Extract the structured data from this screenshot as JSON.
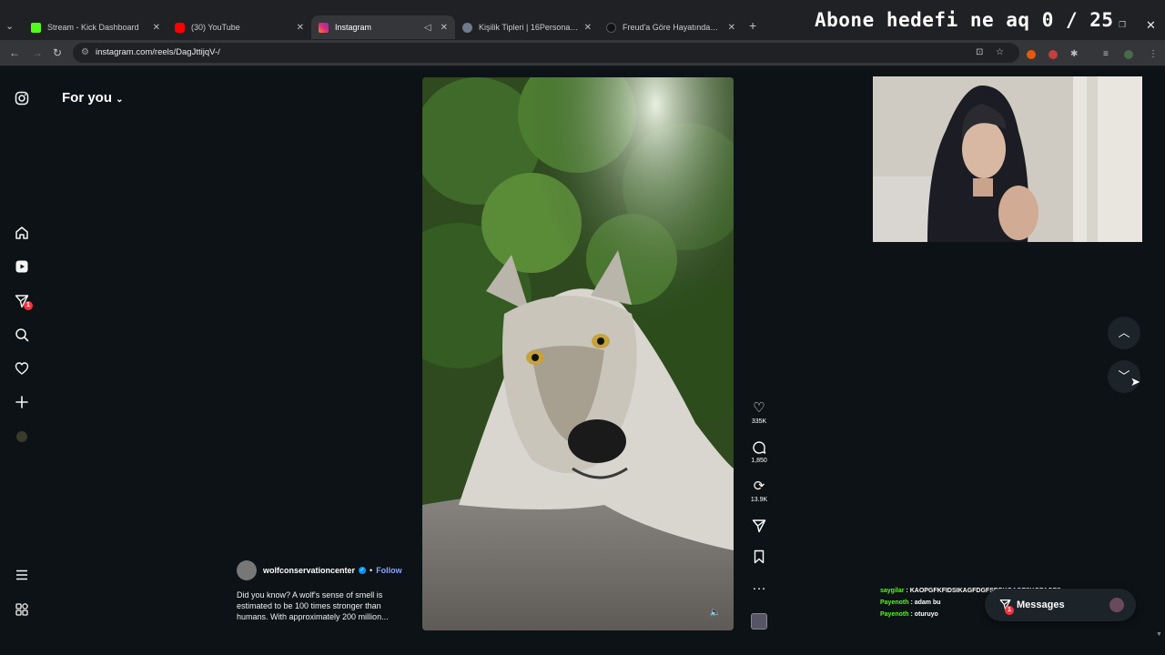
{
  "browser": {
    "tabs": [
      {
        "label": "Stream - Kick Dashboard",
        "color": "#53fc18",
        "active": false
      },
      {
        "label": "(30) YouTube",
        "color": "#ff0000",
        "active": false
      },
      {
        "label": "Instagram",
        "color": "#e1306c",
        "active": true
      },
      {
        "label": "Kişilik Tipleri | 16Personalities",
        "color": "#6f7b8a",
        "active": false
      },
      {
        "label": "Freud'a Göre Hayatındaki Eksik...",
        "color": "#222222",
        "active": false
      }
    ],
    "url": "instagram.com/reels/DagJttijqV-/"
  },
  "stream_overlay": {
    "title": "Abone hedefi ne aq 0 / 25"
  },
  "instagram": {
    "feed_selector": "For you",
    "notification_count": "1",
    "reel": {
      "author": "wolfconservationcenter",
      "follow_label": "Follow",
      "caption": "Did you know? A wolf's sense of smell is estimated to be 100 times stronger than humans. With approximately 200 million...",
      "likes": "335K",
      "comments": "1,850",
      "reposts": "13.9K"
    },
    "messages_label": "Messages",
    "messages_badge": "1"
  },
  "chat": [
    {
      "user": "saygilar",
      "message": "KAOPGFKFIDSIKAGFDGFSDPKOAGFSKOPAGFS",
      "color": "#53fc18"
    },
    {
      "user": "Payenoth",
      "message": "adam bu",
      "color": "#53fc18"
    },
    {
      "user": "Payenoth",
      "message": "oturuyo",
      "color": "#53fc18"
    }
  ],
  "icons": {
    "instagram_logo": "instagram-logo-icon",
    "home": "home-icon",
    "reels": "reels-icon",
    "messages": "paper-plane-icon",
    "search": "search-icon",
    "notifications": "heart-icon",
    "create": "plus-icon",
    "menu": "hamburger-icon",
    "also_from_meta": "grid-icon"
  }
}
